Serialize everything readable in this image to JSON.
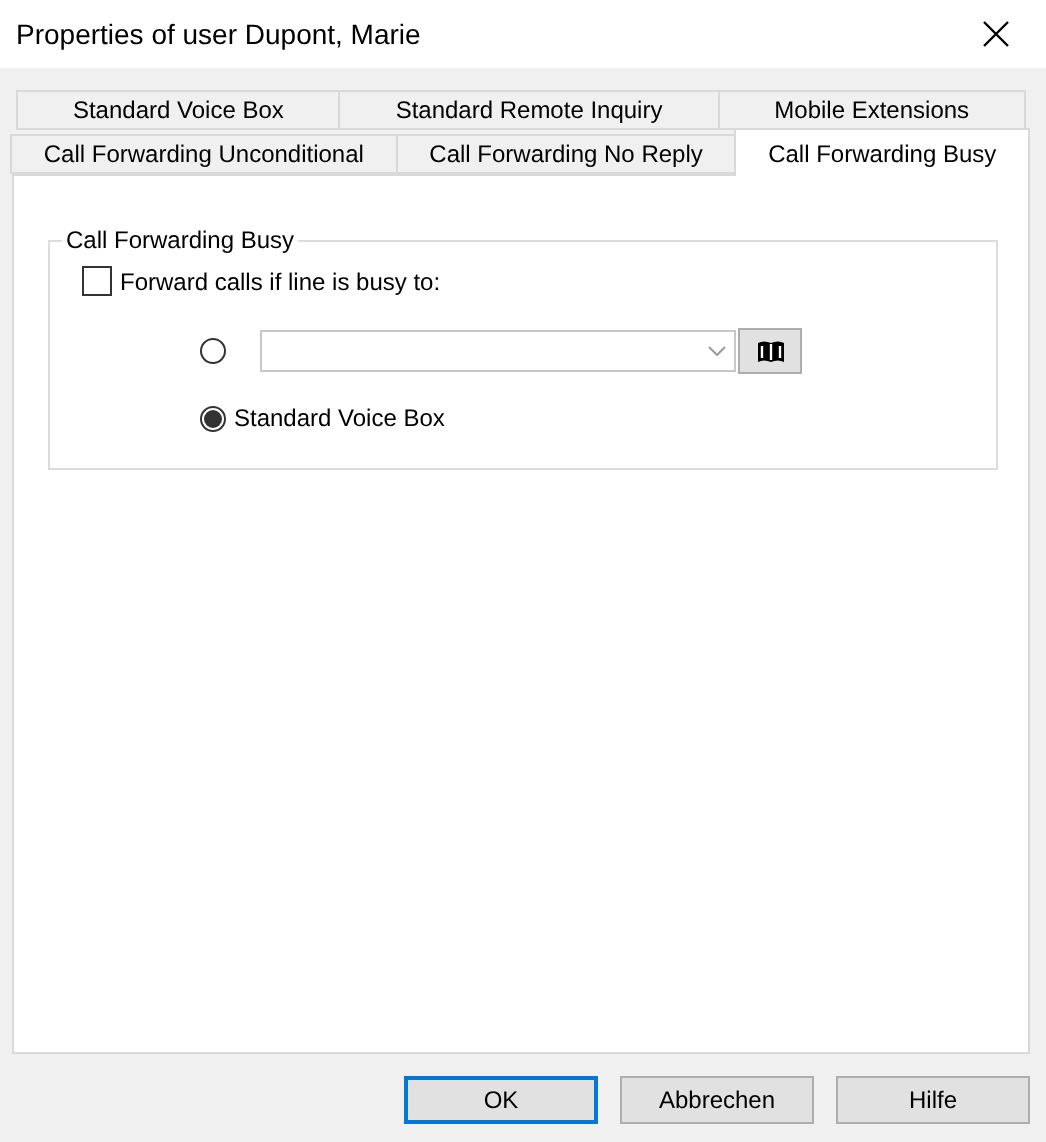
{
  "window": {
    "title": "Properties of user Dupont, Marie"
  },
  "tab_rows": [
    [
      {
        "label": "Standard Voice Box",
        "selected": false
      },
      {
        "label": "Standard Remote Inquiry",
        "selected": false
      },
      {
        "label": "Mobile Extensions",
        "selected": false
      }
    ],
    [
      {
        "label": "Call Forwarding Unconditional",
        "selected": false
      },
      {
        "label": "Call Forwarding No Reply",
        "selected": false
      },
      {
        "label": "Call Forwarding Busy",
        "selected": true
      }
    ]
  ],
  "group": {
    "title": "Call Forwarding Busy",
    "checkbox": {
      "label": "Forward calls if line is busy to:",
      "checked": false
    },
    "options": [
      {
        "kind": "target",
        "selected": false
      },
      {
        "kind": "voice_box",
        "label": "Standard Voice Box",
        "selected": true
      }
    ]
  },
  "buttons": [
    {
      "label": "OK",
      "default": true
    },
    {
      "label": "Abbrechen",
      "default": false
    },
    {
      "label": "Hilfe",
      "default": false
    }
  ]
}
